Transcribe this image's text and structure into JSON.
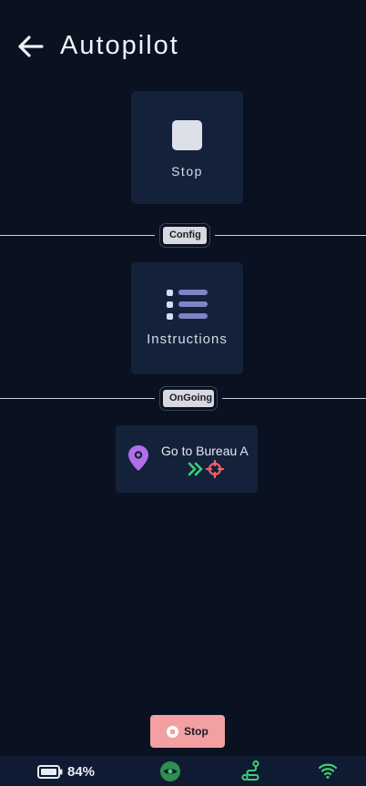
{
  "header": {
    "title": "Autopilot",
    "back_icon": "arrow-left-icon"
  },
  "tiles": {
    "stop": {
      "label": "Stop",
      "icon": "stop-square-icon"
    },
    "instructions": {
      "label": "Instructions",
      "icon": "list-icon"
    }
  },
  "dividers": {
    "config": "Config",
    "ongoing": "OnGoing"
  },
  "task": {
    "title": "Go to Bureau A",
    "icons": [
      "location-pin-icon",
      "double-chevron-right-icon",
      "crosshair-target-icon"
    ]
  },
  "stop_button": {
    "label": "Stop"
  },
  "status_bar": {
    "battery_percent": "84%",
    "icons": [
      "battery-icon",
      "eye-icon",
      "route-icon",
      "wifi-icon"
    ]
  },
  "colors": {
    "background": "#0a1120",
    "card": "#14213b",
    "status_bar": "#0f1a33",
    "stop_button": "#f2a0a2",
    "pin": "#b06ee8",
    "chevron": "#3ecf6f",
    "target": "#f0606a",
    "status_icons": "#3ecf6f",
    "list_bar": "#7c86c6"
  }
}
